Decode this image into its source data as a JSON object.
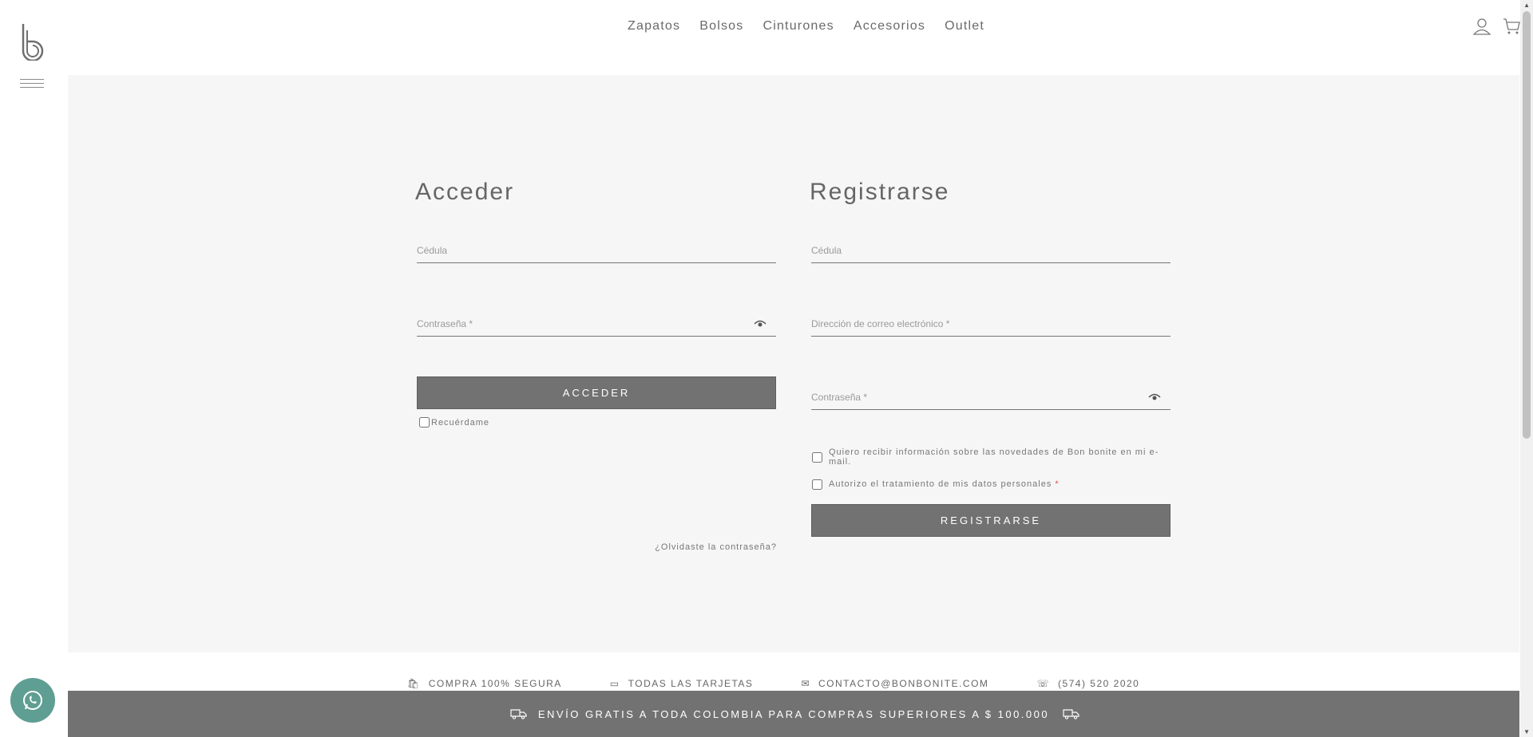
{
  "nav": {
    "items": [
      "Zapatos",
      "Bolsos",
      "Cinturones",
      "Accesorios",
      "Outlet"
    ]
  },
  "login": {
    "title": "Acceder",
    "cedula_placeholder": "Cédula",
    "password_placeholder": "Contraseña *",
    "button_label": "ACCEDER",
    "remember_label": "Recuérdame",
    "forgot_label": "¿Olvidaste la contraseña?"
  },
  "register": {
    "title": "Registrarse",
    "cedula_placeholder": "Cédula",
    "email_placeholder": "Dirección de correo electrónico *",
    "password_placeholder": "Contraseña *",
    "newsletter_label": "Quiero recibir información sobre las novedades de Bon bonite en mi e-mail.",
    "privacy_label": "Autorizo el tratamiento de mis datos personales",
    "privacy_required": "*",
    "button_label": "REGISTRARSE"
  },
  "features": [
    "COMPRA 100% SEGURA",
    "TODAS LAS TARJETAS",
    "CONTACTO@BONBONITE.COM",
    "(574) 520 2020"
  ],
  "banner": {
    "text": "ENVÍO GRATIS A TODA COLOMBIA PARA COMPRAS SUPERIORES A $ 100.000"
  },
  "colors": {
    "accent": "#727272",
    "background": "#f6f6f6",
    "whatsapp": "#5f9e92"
  }
}
